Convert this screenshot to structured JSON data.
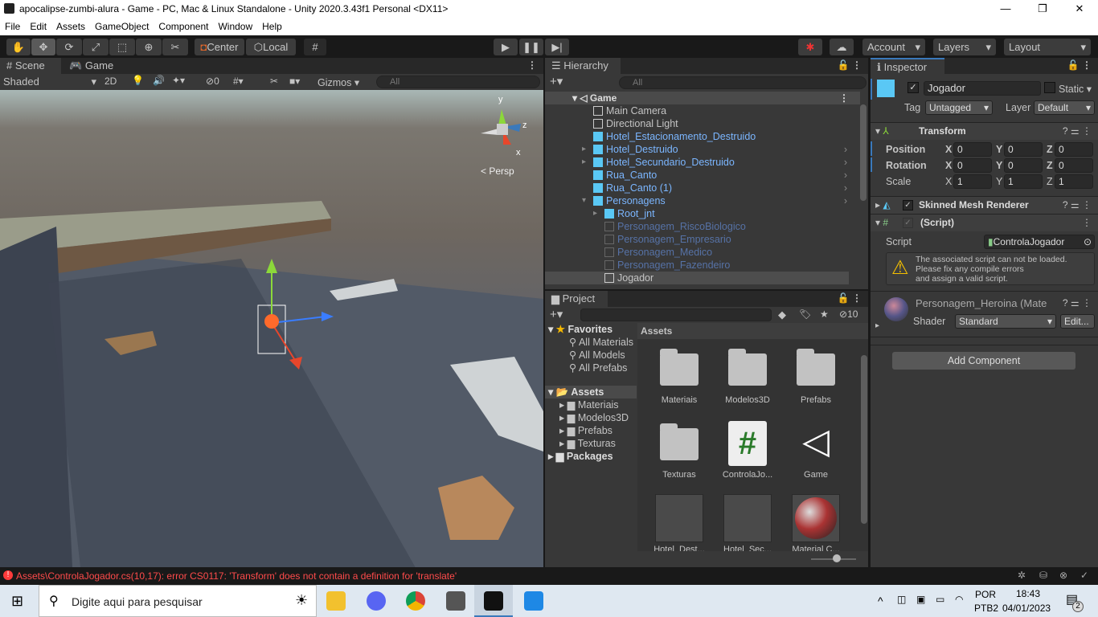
{
  "window": {
    "title": "apocalipse-zumbi-alura - Game - PC, Mac & Linux Standalone - Unity 2020.3.43f1 Personal <DX11>"
  },
  "menu": [
    "File",
    "Edit",
    "Assets",
    "GameObject",
    "Component",
    "Window",
    "Help"
  ],
  "toolbar": {
    "pivot": "Center",
    "space": "Local",
    "account": "Account",
    "layers": "Layers",
    "layout": "Layout"
  },
  "scene": {
    "tabs": [
      "Scene",
      "Game"
    ],
    "shading": "Shaded",
    "mode2d": "2D",
    "hidden_count": "0",
    "gizmos": "Gizmos",
    "search_placeholder": "All",
    "persp": "Persp",
    "axes": {
      "x": "x",
      "y": "y",
      "z": "z"
    }
  },
  "hierarchy": {
    "title": "Hierarchy",
    "search_placeholder": "All",
    "scene": "Game",
    "items": [
      {
        "label": "Main Camera",
        "style": "normal"
      },
      {
        "label": "Directional Light",
        "style": "normal"
      },
      {
        "label": "Hotel_Estacionamento_Destruido",
        "style": "prefab"
      },
      {
        "label": "Hotel_Destruido",
        "style": "prefab"
      },
      {
        "label": "Hotel_Secundario_Destruido",
        "style": "prefab"
      },
      {
        "label": "Rua_Canto",
        "style": "prefab"
      },
      {
        "label": "Rua_Canto (1)",
        "style": "prefab"
      },
      {
        "label": "Personagens",
        "style": "prefab"
      },
      {
        "label": "Root_jnt",
        "style": "prefab"
      },
      {
        "label": "Personagem_RiscoBiologico",
        "style": "disabled"
      },
      {
        "label": "Personagem_Empresario",
        "style": "disabled"
      },
      {
        "label": "Personagem_Medico",
        "style": "disabled"
      },
      {
        "label": "Personagem_Fazendeiro",
        "style": "disabled"
      },
      {
        "label": "Jogador",
        "style": "selected"
      }
    ]
  },
  "project": {
    "title": "Project",
    "hidden_count": "10",
    "tree": {
      "favorites": "Favorites",
      "fav_items": [
        "All Materials",
        "All Models",
        "All Prefabs"
      ],
      "assets": "Assets",
      "asset_folders": [
        "Materiais",
        "Modelos3D",
        "Prefabs",
        "Texturas"
      ],
      "packages": "Packages"
    },
    "breadcrumb": "Assets",
    "grid": [
      "Materiais",
      "Modelos3D",
      "Prefabs",
      "Texturas",
      "ControlaJo...",
      "Game",
      "Hotel_Dest...",
      "Hotel_Sec...",
      "Material C..."
    ]
  },
  "inspector": {
    "title": "Inspector",
    "name": "Jogador",
    "static": "Static",
    "tag_label": "Tag",
    "tag": "Untagged",
    "layer_label": "Layer",
    "layer": "Default",
    "transform": {
      "title": "Transform",
      "rows": [
        {
          "label": "Position",
          "x": "0",
          "y": "0",
          "z": "0"
        },
        {
          "label": "Rotation",
          "x": "0",
          "y": "0",
          "z": "0"
        },
        {
          "label": "Scale",
          "x": "1",
          "y": "1",
          "z": "1"
        }
      ]
    },
    "smr": "Skinned Mesh Renderer",
    "script": {
      "title": "(Script)",
      "label": "Script",
      "value": "ControlaJogador",
      "warning": [
        "The associated script can not be loaded.",
        "Please fix any compile errors",
        "and assign a valid script."
      ]
    },
    "material": {
      "name": "Personagem_Heroina (Mate",
      "shader_label": "Shader",
      "shader": "Standard",
      "edit": "Edit..."
    },
    "add_component": "Add Component"
  },
  "status": {
    "error": "Assets\\ControlaJogador.cs(10,17): error CS0117: 'Transform' does not contain a definition for 'translate'"
  },
  "taskbar": {
    "search_placeholder": "Digite aqui para pesquisar",
    "lang1": "POR",
    "lang2": "PTB2",
    "time": "18:43",
    "date": "04/01/2023",
    "notifications": "2"
  },
  "colors": {
    "accent": "#3a79bb",
    "prefab": "#7bb6ff",
    "error": "#ff4b4b"
  }
}
